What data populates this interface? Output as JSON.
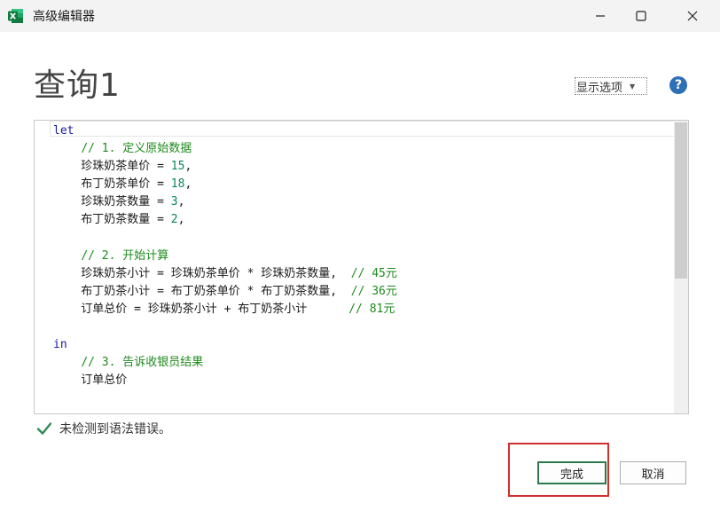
{
  "window": {
    "title": "高级编辑器",
    "app_icon": "excel-icon",
    "controls": [
      "minimize-icon",
      "maximize-icon",
      "close-icon"
    ]
  },
  "query": {
    "title": "查询1"
  },
  "toolbar": {
    "display_options_label": "显示选项",
    "help_icon": "help-icon"
  },
  "editor": {
    "lines": [
      [
        {
          "t": "let",
          "c": "kw"
        }
      ],
      [
        {
          "t": "    "
        },
        {
          "t": "// 1. 定义原始数据",
          "c": "cm"
        }
      ],
      [
        {
          "t": "    珍珠奶茶单价 = "
        },
        {
          "t": "15",
          "c": "nm"
        },
        {
          "t": ","
        }
      ],
      [
        {
          "t": "    布丁奶茶单价 = "
        },
        {
          "t": "18",
          "c": "nm"
        },
        {
          "t": ","
        }
      ],
      [
        {
          "t": "    珍珠奶茶数量 = "
        },
        {
          "t": "3",
          "c": "nm"
        },
        {
          "t": ","
        }
      ],
      [
        {
          "t": "    布丁奶茶数量 = "
        },
        {
          "t": "2",
          "c": "nm"
        },
        {
          "t": ","
        }
      ],
      [],
      [
        {
          "t": "    "
        },
        {
          "t": "// 2. 开始计算",
          "c": "cm"
        }
      ],
      [
        {
          "t": "    珍珠奶茶小计 = 珍珠奶茶单价 * 珍珠奶茶数量,  "
        },
        {
          "t": "// 45元",
          "c": "cm"
        }
      ],
      [
        {
          "t": "    布丁奶茶小计 = 布丁奶茶单价 * 布丁奶茶数量,  "
        },
        {
          "t": "// 36元",
          "c": "cm"
        }
      ],
      [
        {
          "t": "    订单总价 = 珍珠奶茶小计 + 布丁奶茶小计      "
        },
        {
          "t": "// 81元",
          "c": "cm"
        }
      ],
      [],
      [
        {
          "t": "in",
          "c": "kw"
        }
      ],
      [
        {
          "t": "    "
        },
        {
          "t": "// 3. 告诉收银员结果",
          "c": "cm"
        }
      ],
      [
        {
          "t": "    订单总价"
        }
      ]
    ],
    "colors": {
      "keyword": "#1a1aa6",
      "comment": "#1e8a1e",
      "number": "#098658"
    }
  },
  "status": {
    "icon": "check-icon",
    "text": "未检测到语法错误。"
  },
  "buttons": {
    "done_label": "完成",
    "cancel_label": "取消"
  },
  "accent": {
    "highlight": "#d32f2f",
    "primary_border": "#2e7a4f"
  }
}
